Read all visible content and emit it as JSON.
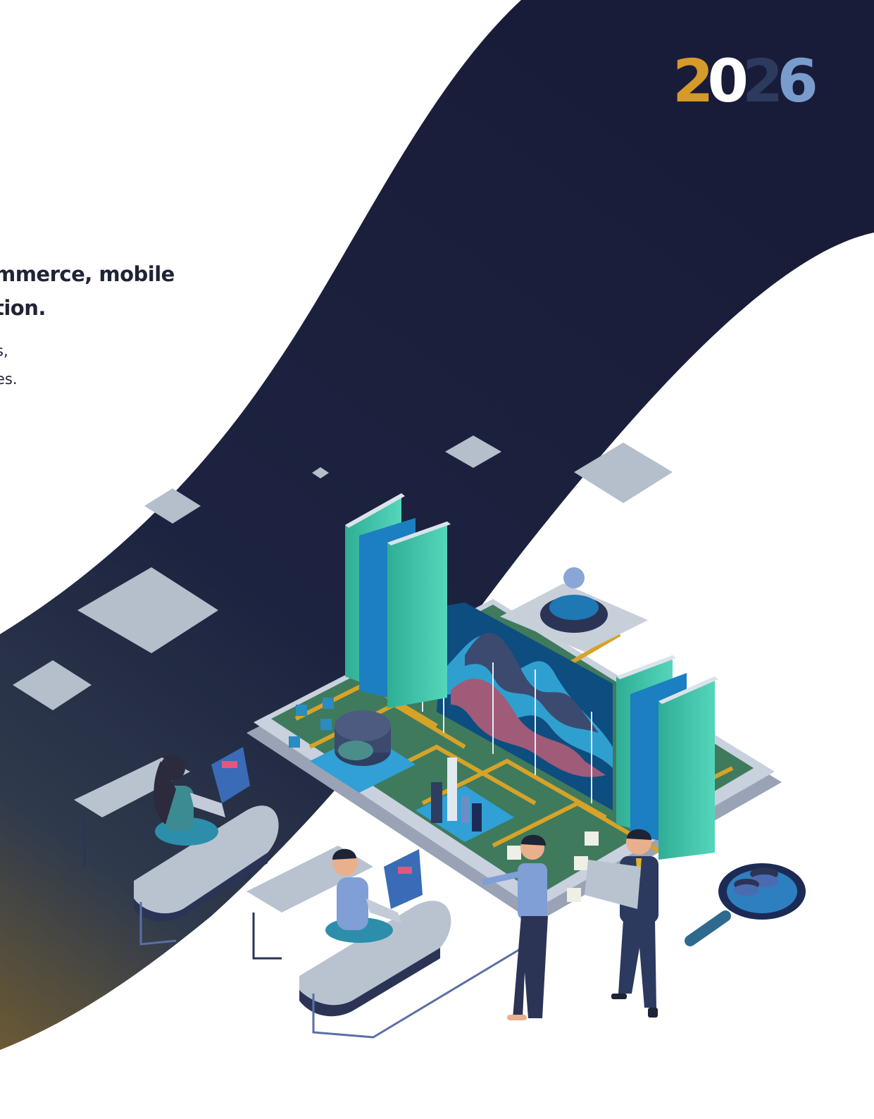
{
  "logo": {
    "digits": [
      "2",
      "0",
      "2",
      "6"
    ],
    "colors": [
      "#d59a2a",
      "#ffffff",
      "#2c3a5e",
      "#7a9ccd"
    ]
  },
  "headline": {
    "line1": "mmerce, mobile",
    "line2": "tion."
  },
  "body": {
    "line1": "s,",
    "line2": "es."
  },
  "colors": {
    "band": "#1b1f3b",
    "band_warm": "#5a4a2a",
    "tile": "#b4bfcb",
    "teal": "#43c4ab",
    "blue": "#1b7fc2",
    "board": "#3f7a5d",
    "gold": "#d6a328"
  },
  "illustration": {
    "icons": [
      "floating-tile-icon",
      "bar-chart-icon",
      "wave-chart-icon",
      "donut-chart-icon",
      "magnifier-coins-icon",
      "laptop-icon",
      "person-icon"
    ]
  }
}
